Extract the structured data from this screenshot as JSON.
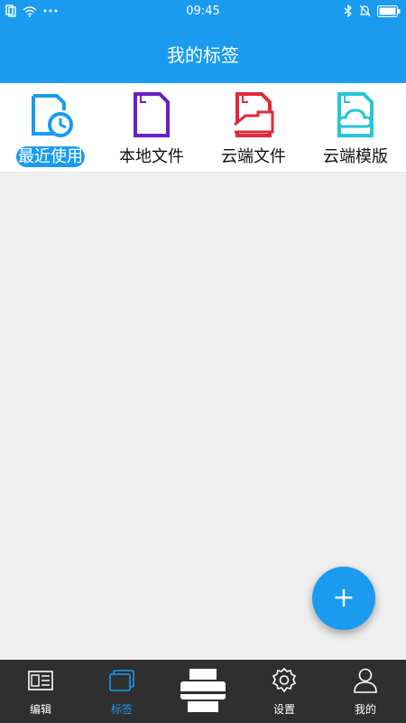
{
  "statusbar": {
    "time": "09:45"
  },
  "header": {
    "title": "我的标签"
  },
  "categories": [
    {
      "label": "最近使用",
      "icon": "recent-file-icon",
      "active": true
    },
    {
      "label": "本地文件",
      "icon": "local-file-icon",
      "active": false
    },
    {
      "label": "云端文件",
      "icon": "cloud-file-icon",
      "active": false
    },
    {
      "label": "云端模版",
      "icon": "cloud-template-icon",
      "active": false
    }
  ],
  "fab": {
    "label": "+"
  },
  "tabbar": [
    {
      "label": "编辑",
      "icon": "edit-icon",
      "active": false
    },
    {
      "label": "标签",
      "icon": "labels-icon",
      "active": true
    },
    {
      "label": "",
      "icon": "printer-icon",
      "active": false
    },
    {
      "label": "设置",
      "icon": "gear-icon",
      "active": false
    },
    {
      "label": "我的",
      "icon": "user-icon",
      "active": false
    }
  ],
  "colors": {
    "accent": "#1a9bf0",
    "tabbar_bg": "#2f2f2f",
    "purple": "#6a1fc6",
    "red": "#e2283c",
    "cyan": "#25c6d8"
  }
}
